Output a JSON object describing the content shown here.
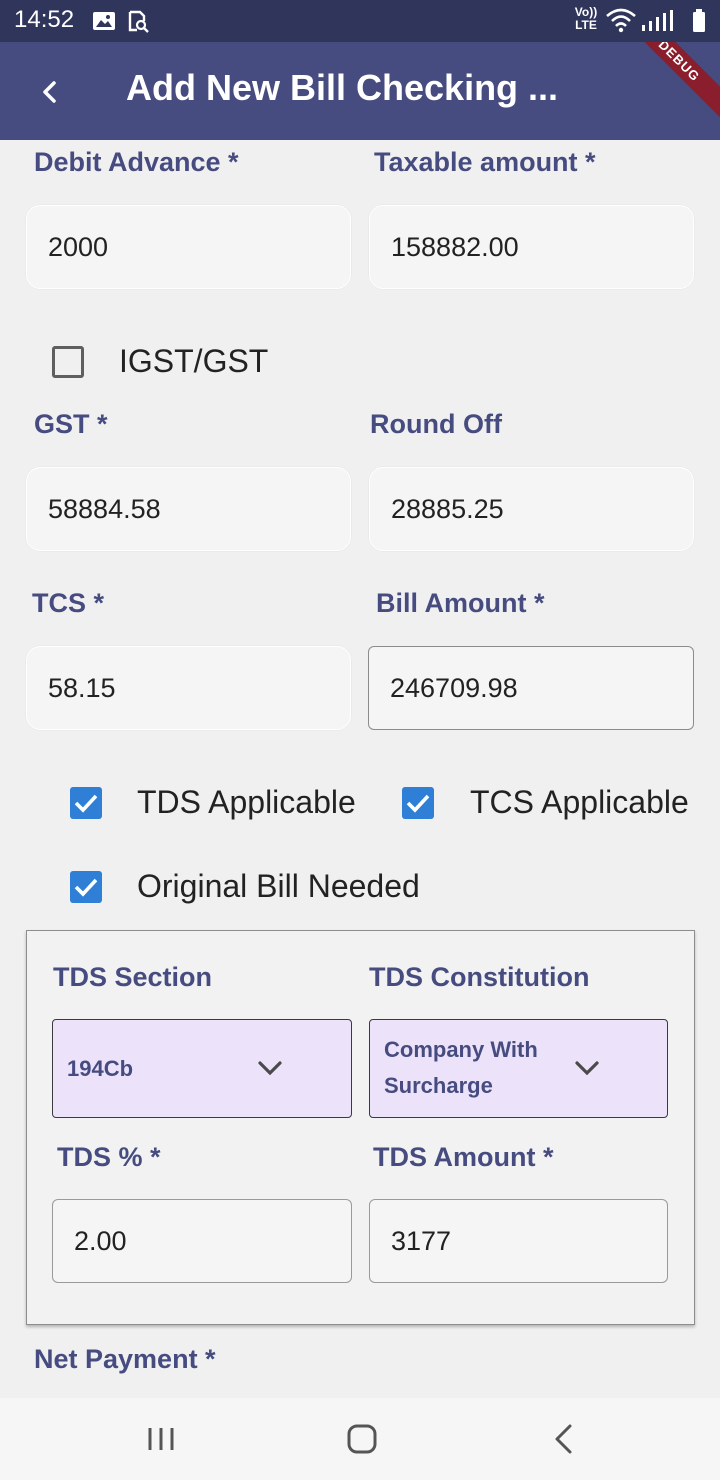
{
  "status_bar": {
    "time": "14:52",
    "left_icons": [
      "image-icon",
      "search-screenshot-icon"
    ],
    "right_icons": [
      "volte-icon",
      "wifi-icon",
      "signal-icon",
      "battery-icon"
    ],
    "volte_line1": "Vo))",
    "volte_line2": "LTE"
  },
  "app_bar": {
    "title": "Add New Bill Checking ...",
    "debug_banner": "DEBUG",
    "background": "#474c80"
  },
  "form": {
    "debit_advance": {
      "label": "Debit Advance *",
      "value": "2000"
    },
    "taxable_amount": {
      "label": "Taxable amount *",
      "value": "158882.00"
    },
    "igst_checkbox": {
      "label": "IGST/GST",
      "checked": false
    },
    "gst": {
      "label": "GST *",
      "value": "58884.58"
    },
    "round_off": {
      "label": "Round Off",
      "value": "28885.25"
    },
    "tcs": {
      "label": "TCS *",
      "value": "58.15"
    },
    "bill_amount": {
      "label": "Bill Amount *",
      "value": "246709.98"
    },
    "tds_applicable": {
      "label": "TDS Applicable",
      "checked": true
    },
    "tcs_applicable": {
      "label": "TCS Applicable",
      "checked": true
    },
    "original_bill": {
      "label": "Original Bill Needed",
      "checked": true
    },
    "net_payment": {
      "label": "Net Payment *"
    }
  },
  "tds_panel": {
    "section": {
      "label": "TDS Section",
      "selected": "194Cb"
    },
    "constitution": {
      "label": "TDS Constitution",
      "selected_line1": "Company With",
      "selected_line2": "Surcharge"
    },
    "percent": {
      "label": "TDS % *",
      "value": "2.00"
    },
    "amount": {
      "label": "TDS Amount *",
      "value": "3177"
    }
  },
  "colors": {
    "accent": "#474c80",
    "checkbox": "#2f7fd6",
    "dropdown_bg": "#ece3fb",
    "status_bar": "#30355c"
  },
  "nav_bar": {
    "buttons": [
      "recent-apps-icon",
      "home-icon",
      "back-icon"
    ]
  }
}
